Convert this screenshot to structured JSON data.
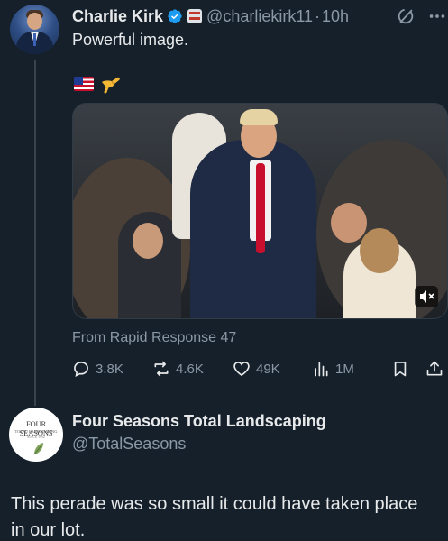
{
  "tweet": {
    "author_name": "Charlie Kirk",
    "author_handle": "@charliekirk11",
    "separator": "·",
    "time_ago": "10h",
    "text": "Powerful image.",
    "media_source": "From Rapid Response 47",
    "stats": {
      "replies": "3.8K",
      "reposts": "4.6K",
      "likes": "49K",
      "views": "1M"
    }
  },
  "reply": {
    "author_name": "Four Seasons Total Landscaping",
    "author_handle": "@TotalSeasons",
    "avatar_logo": {
      "line1": "FOUR SEASONS",
      "line2": "TOTAL LANDSCAPING",
      "line3": "SINCE 1992"
    },
    "text": "This perade was so small it could have taken place in our lot."
  },
  "colors": {
    "background": "#15202b",
    "text_primary": "#e7e9ea",
    "text_secondary": "#8b98a5",
    "verified_blue": "#1d9bf0"
  },
  "icons": {
    "verified": "verified-badge-icon",
    "affiliate": "affiliate-badge-icon",
    "grok": "grok-icon",
    "more": "more-icon",
    "reply": "reply-icon",
    "repost": "repost-icon",
    "like": "heart-icon",
    "views": "views-icon",
    "bookmark": "bookmark-icon",
    "share": "share-icon",
    "mute": "mute-icon"
  }
}
